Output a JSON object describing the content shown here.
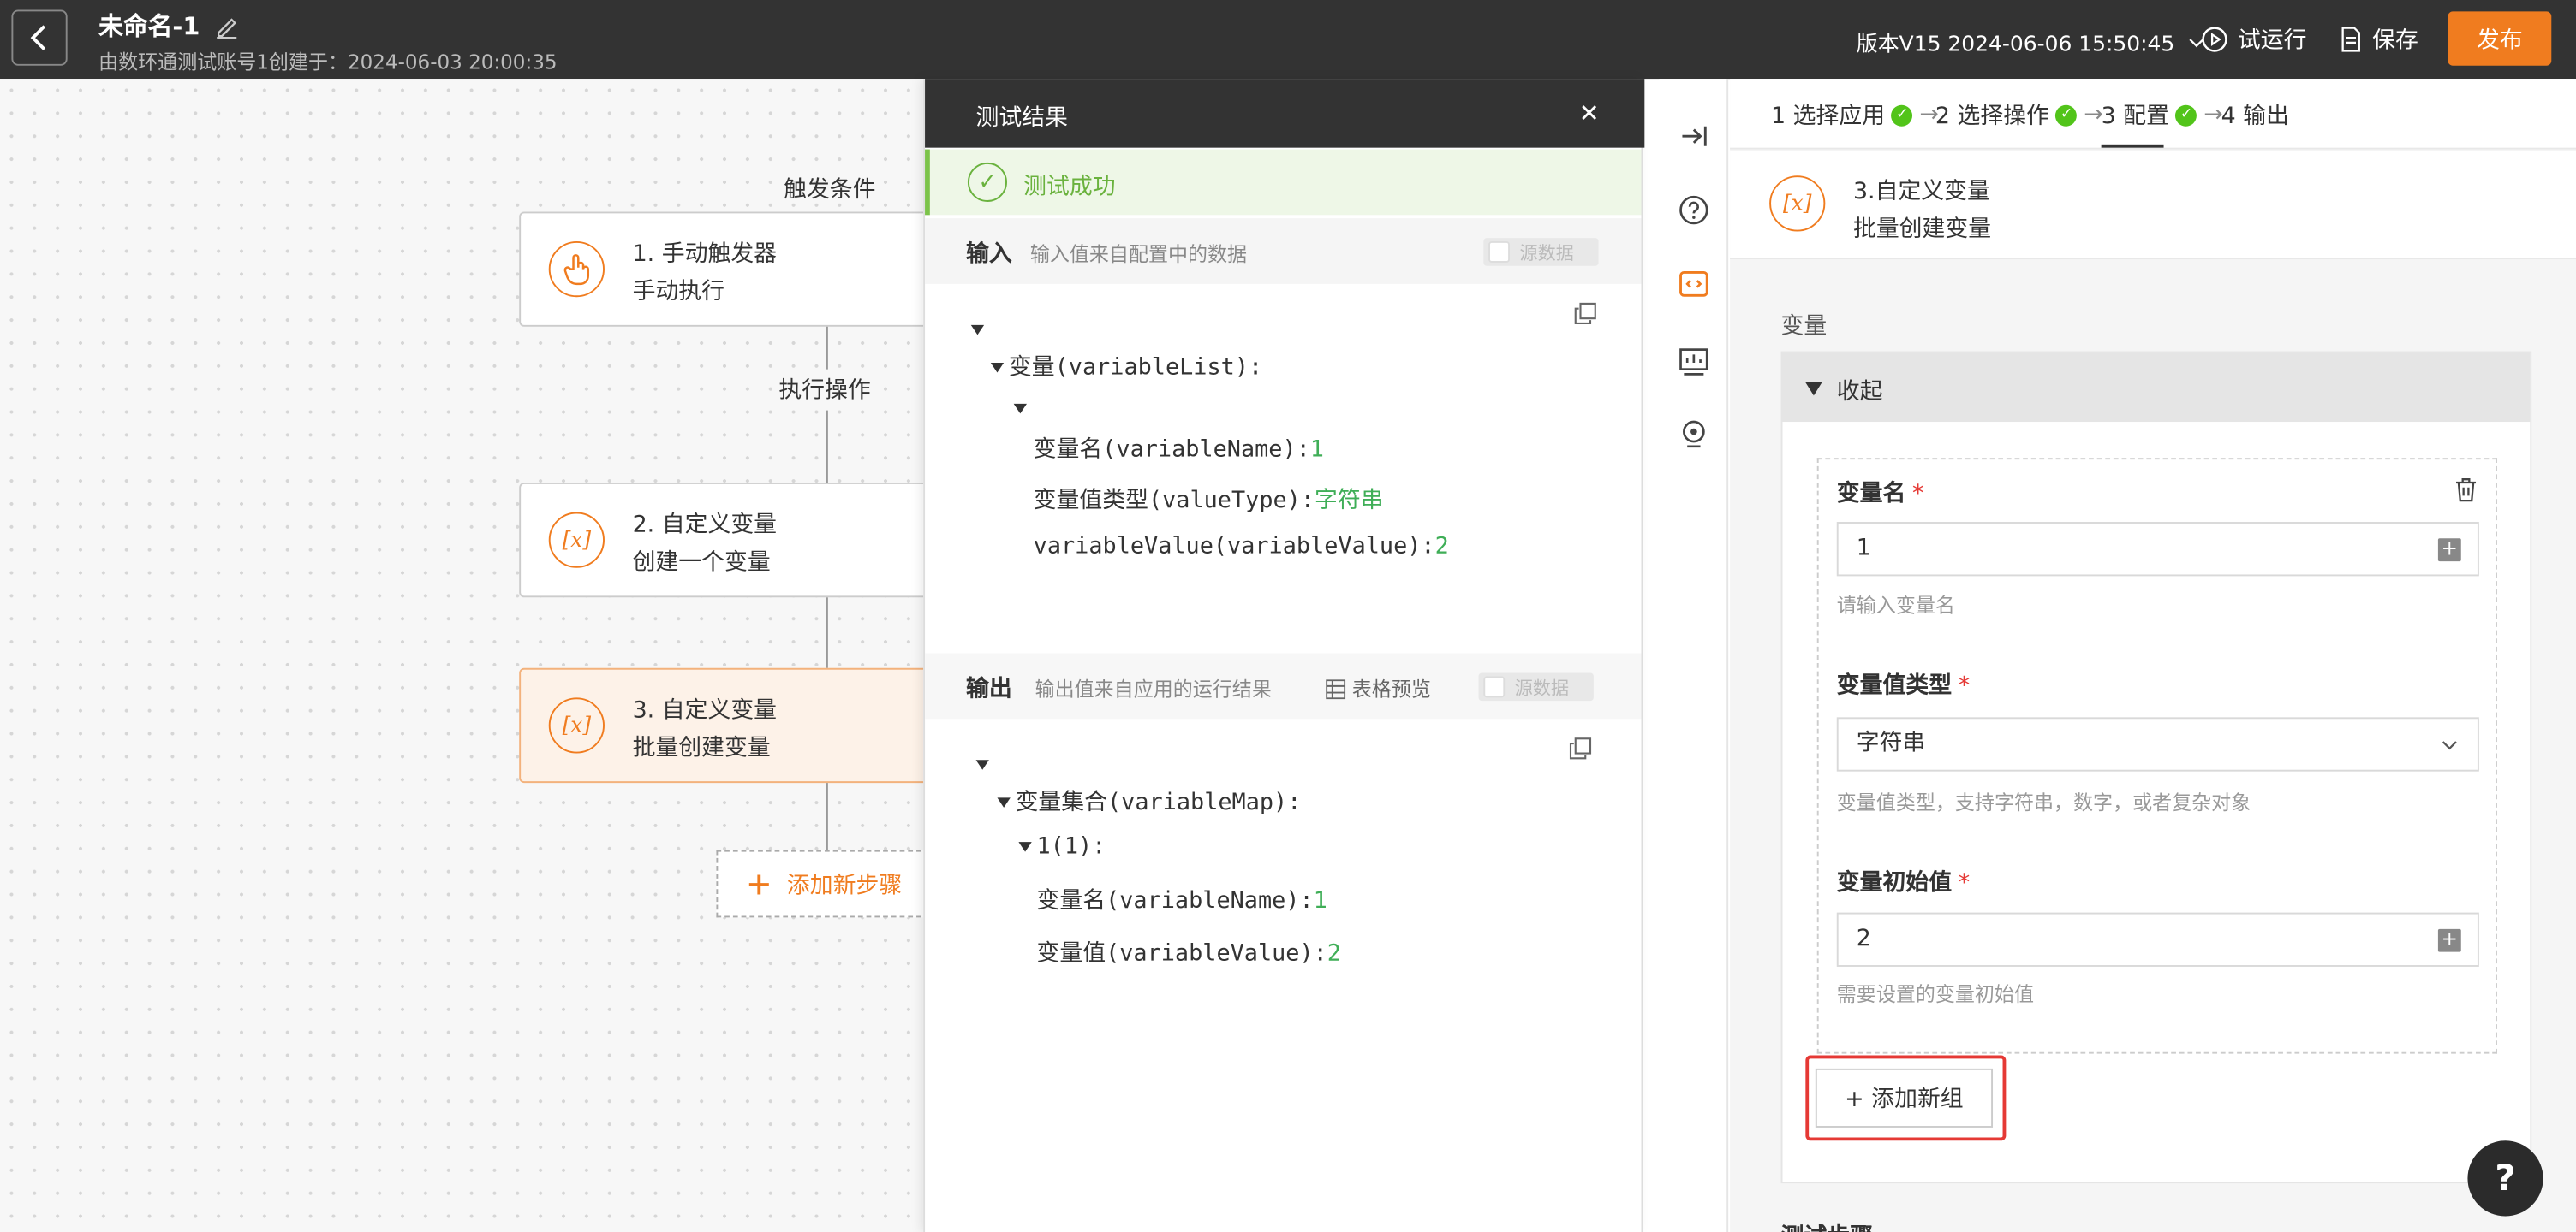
{
  "header": {
    "title": "未命名-1",
    "subtitle": "由数环通测试账号1创建于：2024-06-03 20:00:35",
    "version": "版本V15 2024-06-06 15:50:45",
    "trial_run": "试运行",
    "save": "保存",
    "publish": "发布"
  },
  "canvas": {
    "trigger_label": "触发条件",
    "exec_label": "执行操作",
    "nodes": [
      {
        "title": "1. 手动触发器",
        "sub": "手动执行",
        "icon": "hand-pointer-icon"
      },
      {
        "title": "2. 自定义变量",
        "sub": "创建一个变量",
        "icon": "variable-icon"
      },
      {
        "title": "3. 自定义变量",
        "sub": "批量创建变量",
        "icon": "variable-icon"
      }
    ],
    "add_step": "添加新步骤"
  },
  "result": {
    "title": "测试结果",
    "success": "测试成功",
    "input": {
      "title": "输入",
      "desc": "输入值来自配置中的数据",
      "toggle_label": "源数据",
      "tree": {
        "list_key": "变量(variableList):",
        "name_key": "变量名(variableName):",
        "name_val": "1",
        "type_key": "变量值类型(valueType):",
        "type_val": "字符串",
        "value_key": "variableValue(variableValue):",
        "value_val": "2"
      }
    },
    "output": {
      "title": "输出",
      "desc": "输出值来自应用的运行结果",
      "table_preview": "表格预览",
      "toggle_label": "源数据",
      "tree": {
        "map_key": "变量集合(variableMap):",
        "item_key": "1(1):",
        "name_key": "变量名(variableName):",
        "name_val": "1",
        "value_key": "变量值(variableValue):",
        "value_val": "2"
      }
    }
  },
  "config": {
    "steps": [
      "1 选择应用",
      "2 选择操作",
      "3 配置",
      "4 输出"
    ],
    "node_title": "3.自定义变量",
    "node_sub": "批量创建变量",
    "section_label": "变量",
    "collapse_label": "收起",
    "fields": {
      "name_label": "变量名",
      "name_value": "1",
      "name_hint": "请输入变量名",
      "type_label": "变量值类型",
      "type_value": "字符串",
      "type_hint": "变量值类型，支持字符串，数字，或者复杂对象",
      "init_label": "变量初始值",
      "init_value": "2",
      "init_hint": "需要设置的变量初始值",
      "required_mark": "*"
    },
    "add_group": "+ 添加新组",
    "bottom_peek": "测试步骤"
  },
  "colors": {
    "accent": "#f07c1f",
    "success": "#6ab23e",
    "header_bg": "#333333",
    "highlight": "#e53935"
  }
}
